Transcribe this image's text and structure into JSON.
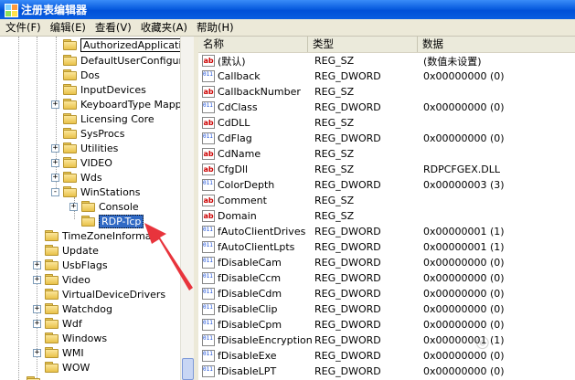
{
  "window": {
    "title": "注册表编辑器"
  },
  "menu": [
    "文件(F)",
    "编辑(E)",
    "查看(V)",
    "收藏夹(A)",
    "帮助(H)"
  ],
  "tree": {
    "items": [
      {
        "label": "AuthorizedApplications",
        "state": "boxed"
      },
      {
        "label": "DefaultUserConfigura"
      },
      {
        "label": "Dos"
      },
      {
        "label": "InputDevices"
      },
      {
        "label": "KeyboardType Mappi",
        "expander": "+"
      },
      {
        "label": "Licensing Core"
      },
      {
        "label": "SysProcs"
      },
      {
        "label": "Utilities",
        "expander": "+"
      },
      {
        "label": "VIDEO",
        "expander": "+"
      },
      {
        "label": "Wds",
        "expander": "+"
      },
      {
        "label": "WinStations",
        "expander": "-"
      },
      {
        "label": "Console",
        "expander": "+"
      },
      {
        "label": "RDP-Tcp",
        "state": "selected"
      },
      {
        "label": "TimeZoneInformat"
      },
      {
        "label": "Update"
      },
      {
        "label": "UsbFlags",
        "expander": "+"
      },
      {
        "label": "Video",
        "expander": "+"
      },
      {
        "label": "VirtualDeviceDrivers"
      },
      {
        "label": "Watchdog",
        "expander": "+"
      },
      {
        "label": "Wdf",
        "expander": "+"
      },
      {
        "label": "Windows"
      },
      {
        "label": "WMI",
        "expander": "+"
      },
      {
        "label": "WOW"
      }
    ]
  },
  "list": {
    "columns": [
      "名称",
      "类型",
      "数据"
    ],
    "rows": [
      {
        "icon": "string-value-icon",
        "name": "(默认)",
        "type": "REG_SZ",
        "data": "(数值未设置)"
      },
      {
        "icon": "binary-value-icon",
        "name": "Callback",
        "type": "REG_DWORD",
        "data": "0x00000000 (0)"
      },
      {
        "icon": "string-value-icon",
        "name": "CallbackNumber",
        "type": "REG_SZ",
        "data": ""
      },
      {
        "icon": "binary-value-icon",
        "name": "CdClass",
        "type": "REG_DWORD",
        "data": "0x00000000 (0)"
      },
      {
        "icon": "string-value-icon",
        "name": "CdDLL",
        "type": "REG_SZ",
        "data": ""
      },
      {
        "icon": "binary-value-icon",
        "name": "CdFlag",
        "type": "REG_DWORD",
        "data": "0x00000000 (0)"
      },
      {
        "icon": "string-value-icon",
        "name": "CdName",
        "type": "REG_SZ",
        "data": ""
      },
      {
        "icon": "string-value-icon",
        "name": "CfgDll",
        "type": "REG_SZ",
        "data": "RDPCFGEX.DLL"
      },
      {
        "icon": "binary-value-icon",
        "name": "ColorDepth",
        "type": "REG_DWORD",
        "data": "0x00000003 (3)"
      },
      {
        "icon": "string-value-icon",
        "name": "Comment",
        "type": "REG_SZ",
        "data": ""
      },
      {
        "icon": "string-value-icon",
        "name": "Domain",
        "type": "REG_SZ",
        "data": ""
      },
      {
        "icon": "binary-value-icon",
        "name": "fAutoClientDrives",
        "type": "REG_DWORD",
        "data": "0x00000001 (1)"
      },
      {
        "icon": "binary-value-icon",
        "name": "fAutoClientLpts",
        "type": "REG_DWORD",
        "data": "0x00000001 (1)"
      },
      {
        "icon": "binary-value-icon",
        "name": "fDisableCam",
        "type": "REG_DWORD",
        "data": "0x00000000 (0)"
      },
      {
        "icon": "binary-value-icon",
        "name": "fDisableCcm",
        "type": "REG_DWORD",
        "data": "0x00000000 (0)"
      },
      {
        "icon": "binary-value-icon",
        "name": "fDisableCdm",
        "type": "REG_DWORD",
        "data": "0x00000000 (0)"
      },
      {
        "icon": "binary-value-icon",
        "name": "fDisableClip",
        "type": "REG_DWORD",
        "data": "0x00000000 (0)"
      },
      {
        "icon": "binary-value-icon",
        "name": "fDisableCpm",
        "type": "REG_DWORD",
        "data": "0x00000000 (0)"
      },
      {
        "icon": "binary-value-icon",
        "name": "fDisableEncryption",
        "type": "REG_DWORD",
        "data": "0x00000001 (1)"
      },
      {
        "icon": "binary-value-icon",
        "name": "fDisableExe",
        "type": "REG_DWORD",
        "data": "0x00000000 (0)"
      },
      {
        "icon": "binary-value-icon",
        "name": "fDisableLPT",
        "type": "REG_DWORD",
        "data": "0x00000000 (0)"
      }
    ]
  },
  "colors": {
    "title_bar": "#0a5ee0",
    "selection": "#316ac5",
    "arrow": "#e8343c"
  }
}
